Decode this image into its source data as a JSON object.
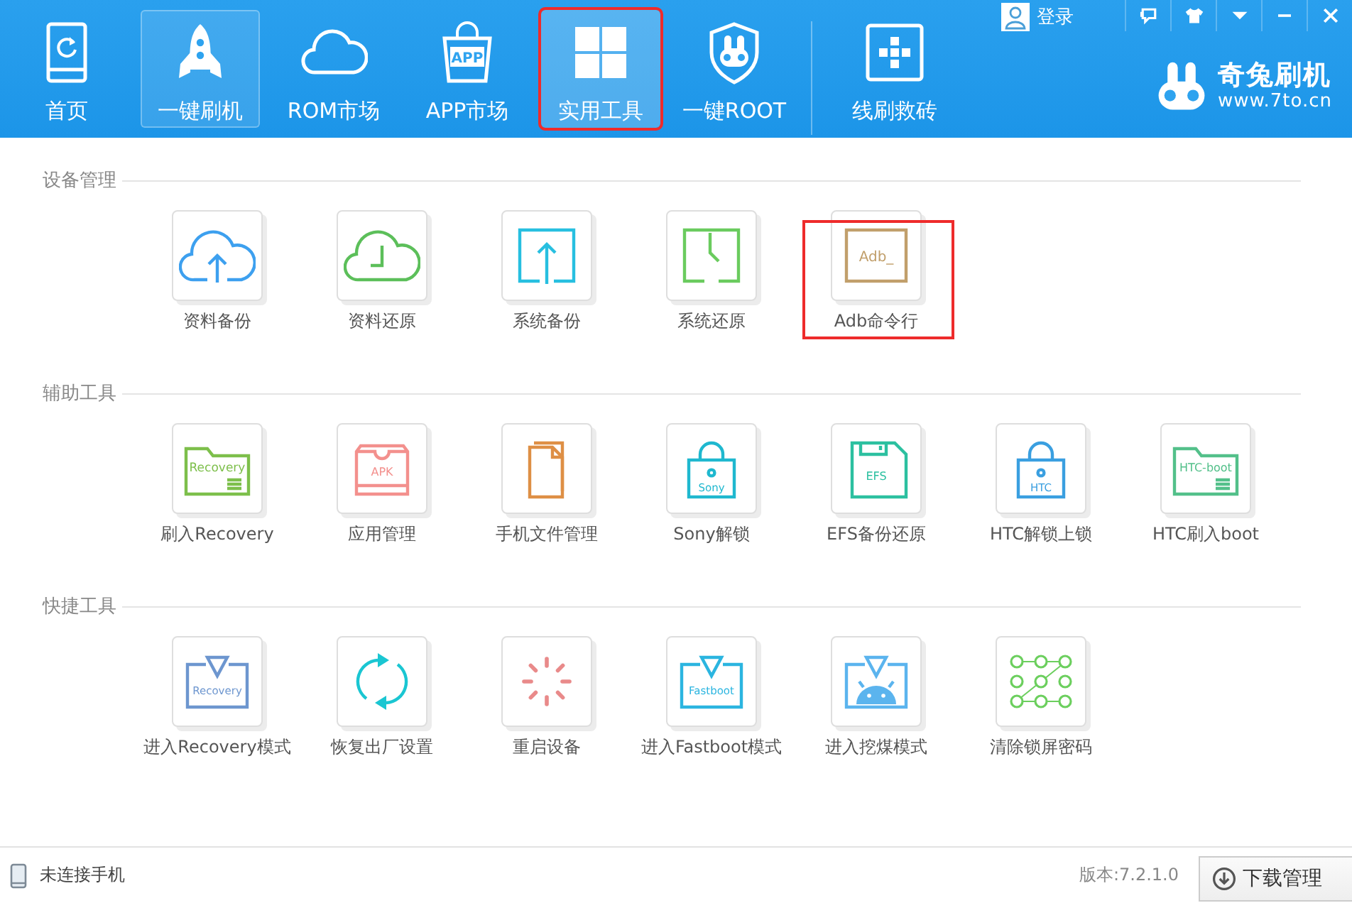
{
  "nav": {
    "items": [
      {
        "label": "首页",
        "selected": false,
        "hovered": false,
        "highlighted": false
      },
      {
        "label": "一键刷机",
        "selected": false,
        "hovered": true,
        "highlighted": false
      },
      {
        "label": "ROM市场",
        "selected": false,
        "hovered": false,
        "highlighted": false
      },
      {
        "label": "APP市场",
        "icon_text": "APP",
        "selected": false,
        "hovered": false,
        "highlighted": false
      },
      {
        "label": "实用工具",
        "selected": true,
        "hovered": false,
        "highlighted": true
      },
      {
        "label": "一键ROOT",
        "selected": false,
        "hovered": false,
        "highlighted": false
      },
      {
        "label": "线刷救砖",
        "selected": false,
        "hovered": false,
        "highlighted": false
      }
    ]
  },
  "account": {
    "login": "登录"
  },
  "logo": {
    "name": "奇兔刷机",
    "url": "www.7to.cn"
  },
  "sections": [
    {
      "title": "设备管理",
      "tools": [
        {
          "label": "资料备份",
          "highlighted": false
        },
        {
          "label": "资料还原",
          "highlighted": false
        },
        {
          "label": "系统备份",
          "highlighted": false
        },
        {
          "label": "系统还原",
          "highlighted": false
        },
        {
          "label": "Adb命令行",
          "icon_text": "Adb_",
          "highlighted": true
        }
      ]
    },
    {
      "title": "辅助工具",
      "tools": [
        {
          "label": "刷入Recovery",
          "icon_text": "Recovery",
          "highlighted": false
        },
        {
          "label": "应用管理",
          "icon_text": "APK",
          "highlighted": false
        },
        {
          "label": "手机文件管理",
          "highlighted": false
        },
        {
          "label": "Sony解锁",
          "icon_text": "Sony",
          "highlighted": false
        },
        {
          "label": "EFS备份还原",
          "icon_text": "EFS",
          "highlighted": false
        },
        {
          "label": "HTC解锁上锁",
          "icon_text": "HTC",
          "highlighted": false
        },
        {
          "label": "HTC刷入boot",
          "icon_text": "HTC-boot",
          "highlighted": false
        }
      ]
    },
    {
      "title": "快捷工具",
      "tools": [
        {
          "label": "进入Recovery模式",
          "icon_text": "Recovery",
          "highlighted": false
        },
        {
          "label": "恢复出厂设置",
          "highlighted": false
        },
        {
          "label": "重启设备",
          "highlighted": false
        },
        {
          "label": "进入Fastboot模式",
          "icon_text": "Fastboot",
          "highlighted": false
        },
        {
          "label": "进入挖煤模式",
          "highlighted": false
        },
        {
          "label": "清除锁屏密码",
          "highlighted": false
        }
      ]
    }
  ],
  "status_bar": {
    "connection": "未连接手机",
    "version": "版本:7.2.1.0",
    "download_button": "下载管理"
  }
}
